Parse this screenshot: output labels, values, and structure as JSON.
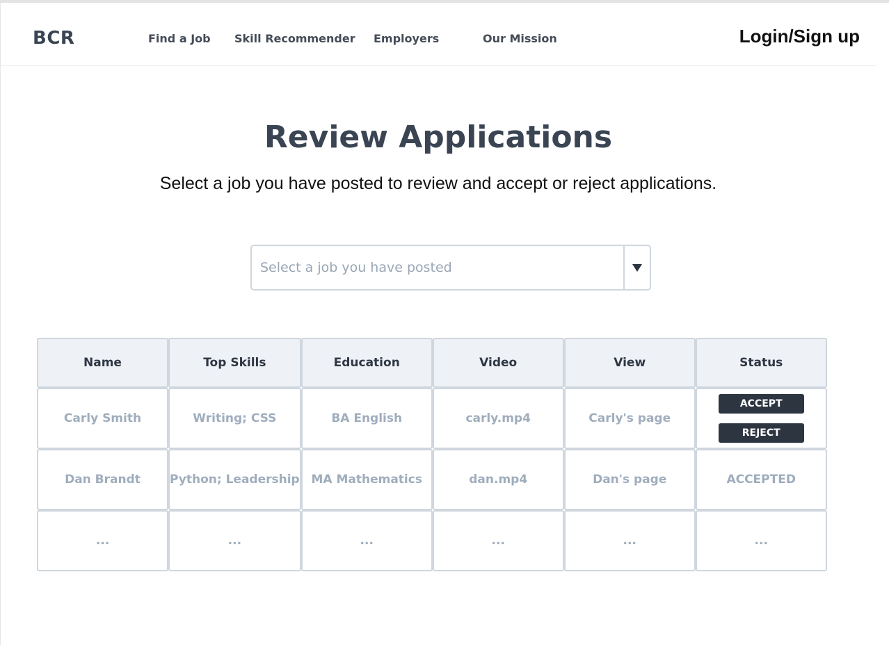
{
  "nav": {
    "brand": "BCR",
    "links": [
      "Find a Job",
      "Skill Recommender",
      "Employers",
      "Our Mission"
    ],
    "login": "Login/Sign up"
  },
  "page": {
    "title": "Review Applications",
    "subtitle": "Select a job you have posted to review and accept or reject applications."
  },
  "job_select": {
    "placeholder": "Select a job you have posted",
    "icon": "caret-down-icon"
  },
  "table": {
    "headers": [
      "Name",
      "Top Skills",
      "Education",
      "Video",
      "View",
      "Status"
    ],
    "rows": [
      {
        "name": "Carly Smith",
        "skills": "Writing; CSS",
        "education": "BA English",
        "video": "carly.mp4",
        "view": "Carly's page",
        "status": "",
        "actions": [
          "ACCEPT",
          "REJECT"
        ]
      },
      {
        "name": "Dan Brandt",
        "skills": "Python; Leadership",
        "education": "MA Mathematics",
        "video": "dan.mp4",
        "view": "Dan's page",
        "status": "ACCEPTED"
      },
      {
        "name": "...",
        "skills": "...",
        "education": "...",
        "video": "...",
        "view": "...",
        "status": "..."
      }
    ]
  },
  "colors": {
    "header_bg": "#eef1f6",
    "border": "#cfd6de",
    "button_bg": "#2d3541",
    "muted_text": "#9fadbd",
    "title_text": "#3a4453"
  }
}
